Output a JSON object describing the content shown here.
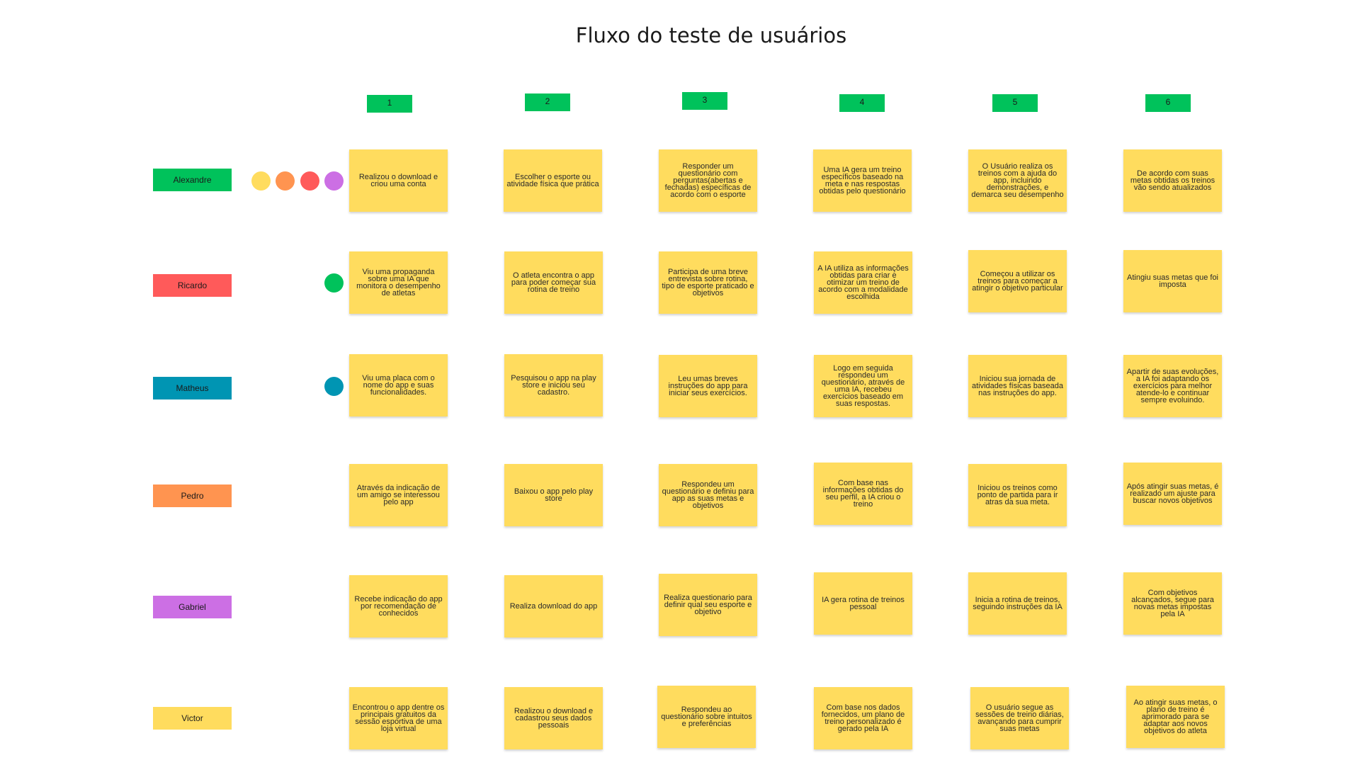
{
  "title": "Fluxo do teste de usuários",
  "steps": [
    "1",
    "2",
    "3",
    "4",
    "5",
    "6"
  ],
  "users": [
    {
      "name": "Alexandre",
      "color": "#00c25b"
    },
    {
      "name": "Ricardo",
      "color": "#ff5a5a"
    },
    {
      "name": "Matheus",
      "color": "#0095b3"
    },
    {
      "name": "Pedro",
      "color": "#ff9450"
    },
    {
      "name": "Gabriel",
      "color": "#cc6fe4"
    },
    {
      "name": "Victor",
      "color": "#ffdc5e"
    }
  ],
  "dot_colors": {
    "yellow": "#ffdc5e",
    "orange": "#ff9450",
    "red": "#ff5a5a",
    "purple": "#cc6fe4",
    "green": "#00c25b",
    "teal": "#0095b3"
  },
  "notes": [
    [
      "Realizou o download e criou uma conta",
      "Escolher o esporte ou atividade física que prática",
      "Responder um questionário com perguntas(abertas e fechadas) específicas de acordo com o esporte",
      "Uma IA gera um treino específicos baseado na meta e nas respostas obtidas pelo questionário",
      "O Usuário realiza os treinos com a ajuda do app, incluindo demonstrações, e demarca seu desempenho",
      "De acordo com suas metas obtidas os treinos vão sendo atualizados"
    ],
    [
      "Viu uma propaganda sobre uma IA que monitora o desempenho de atletas",
      "O atleta encontra o app para poder começar sua rotina de treino",
      "Participa de uma breve entrevista sobre rotina, tipo de esporte praticado e objetivos",
      "A IA utiliza as informações obtidas para criar e otimizar um treino de acordo com a modalidade escolhida",
      "Começou a utilizar os treinos para começar a atingir o objetivo particular",
      "Atingiu suas metas que foi imposta"
    ],
    [
      "Viu uma placa com o nome do app e suas funcionalidades.",
      "Pesquisou o app na play store e iniciou seu cadastro.",
      "Leu umas breves instruções do app para iniciar seus exercícios.",
      "Logo em seguida respondeu um questionário, através de uma IA, recebeu exercícios baseado em suas respostas.",
      "Iniciou sua jornada de atividades físicas baseada nas instruções do app.",
      "Apartir de suas evoluções, a IA foi adaptando os exercícios para melhor atende-lo e continuar sempre evoluindo."
    ],
    [
      "Através da indicação de um amigo se interessou pelo app",
      "Baixou o app pelo play store",
      "Respondeu um questionário e definiu para app as suas metas e objetivos",
      "Com base nas informações obtidas do seu perfil, a IA criou o treino",
      "Iniciou os treinos como ponto de partida para ir atras da sua meta.",
      "Após atingir suas metas, é realizado um ajuste para buscar novos objetivos"
    ],
    [
      "Recebe indicação do app por recomendação de conhecidos",
      "Realiza download do app",
      "Realiza questionario para definir qual seu esporte e objetivo",
      "IA gera rotina de treinos pessoal",
      "Inicia a rotina de treinos, seguindo instruções da IA",
      "Com objetivos alcançados, segue para novas metas impostas pela IA"
    ],
    [
      "Encontrou o app dentre os principais gratuitos da sessão esportiva de uma loja virtual",
      "Realizou o download e cadastrou seus dados pessoais",
      "Respondeu ao questionário sobre intuitos e preferências",
      "Com base nos dados fornecidos, um plano de treino personalizado é gerado pela IA",
      "O usuário segue as sessões de treino diárias, avançando para cumprir suas metas",
      "Ao atingir suas metas, o plano de treino é aprimorado para se adaptar aos novos objetivos do atleta"
    ]
  ]
}
